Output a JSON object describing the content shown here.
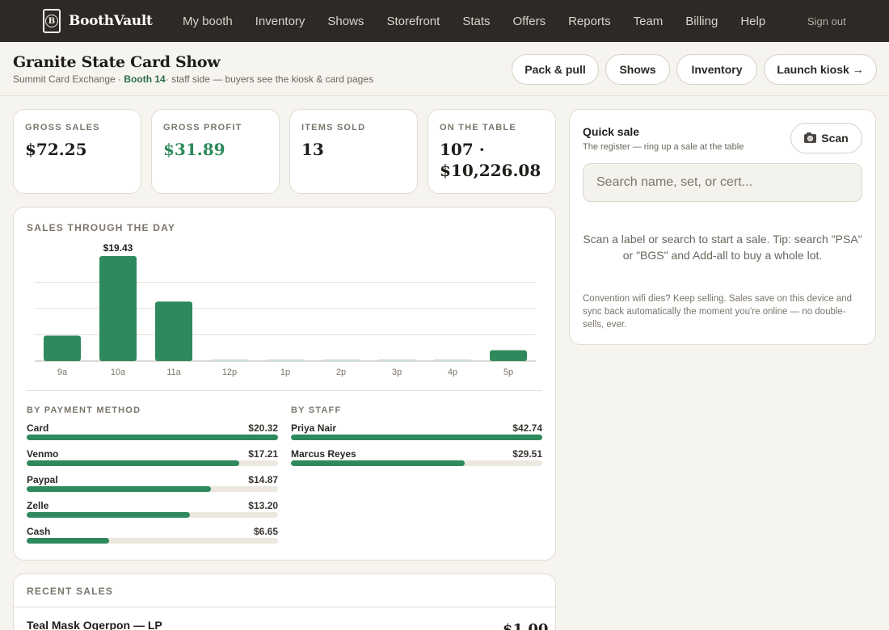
{
  "app": {
    "brand_letter": "B",
    "brand_name": "BoothVault"
  },
  "nav": {
    "links": [
      "My booth",
      "Inventory",
      "Shows",
      "Storefront",
      "Stats",
      "Offers",
      "Reports",
      "Team",
      "Billing",
      "Help"
    ],
    "sign_out": "Sign out"
  },
  "header": {
    "title": "Granite State Card Show",
    "venue": "Summit Card Exchange · ",
    "booth": "Booth 14",
    "note": "· staff side — buyers see the kiosk & card pages",
    "buttons": [
      "Pack & pull",
      "Shows",
      "Inventory",
      "Launch kiosk →"
    ]
  },
  "kpis": [
    {
      "label": "Gross sales",
      "value": "$72.25"
    },
    {
      "label": "Gross profit",
      "value": "$31.89"
    },
    {
      "label": "Items sold",
      "value": "13"
    },
    {
      "label": "On the table",
      "value_line1": "107 ·",
      "value_line2": "$10,226.08"
    }
  ],
  "sales_chart": {
    "label": "Sales through the day"
  },
  "chart_data": {
    "type": "bar",
    "title": "Sales through the day",
    "categories": [
      "9a",
      "10a",
      "11a",
      "12p",
      "1p",
      "2p",
      "3p",
      "4p",
      "5p"
    ],
    "values": [
      4.7,
      19.43,
      11.0,
      0,
      0,
      0,
      0,
      0,
      2.0
    ],
    "data_labels": [
      {
        "category": "10a",
        "text": "$19.43"
      }
    ],
    "ylim": [
      0,
      19.43
    ],
    "grid": true,
    "color": "#2e8a5c"
  },
  "by_payment": {
    "label": "By payment method",
    "max": 20.32,
    "items": [
      {
        "name": "Card",
        "value": 20.32,
        "display": "$20.32"
      },
      {
        "name": "Venmo",
        "value": 17.21,
        "display": "$17.21"
      },
      {
        "name": "Paypal",
        "value": 14.87,
        "display": "$14.87"
      },
      {
        "name": "Zelle",
        "value": 13.2,
        "display": "$13.20"
      },
      {
        "name": "Cash",
        "value": 6.65,
        "display": "$6.65"
      }
    ]
  },
  "by_staff": {
    "label": "By staff",
    "max": 42.74,
    "items": [
      {
        "name": "Priya Nair",
        "value": 42.74,
        "display": "$42.74"
      },
      {
        "name": "Marcus Reyes",
        "value": 29.51,
        "display": "$29.51"
      }
    ]
  },
  "quick_sale": {
    "title": "Quick sale",
    "subtitle": "The register — ring up a sale at the table",
    "scan_label": "Scan",
    "search_placeholder": "Search name, set, or cert...",
    "hint": "Scan a label or search to start a sale. Tip: search \"PSA\" or \"BGS\" and Add-all to buy a whole lot.",
    "note": "Convention wifi dies? Keep selling. Sales save on this device and sync back automatically the moment you're online — no double-sells, ever."
  },
  "recent_sales": {
    "label": "Recent sales",
    "rows": [
      {
        "title": "Teal Mask Ogerpon — LP",
        "price": "$1.00"
      }
    ]
  },
  "colors": {
    "nav_bg": "#2d2926",
    "accent_green": "#2e8a5c",
    "page_bg": "#f6f4ef"
  }
}
